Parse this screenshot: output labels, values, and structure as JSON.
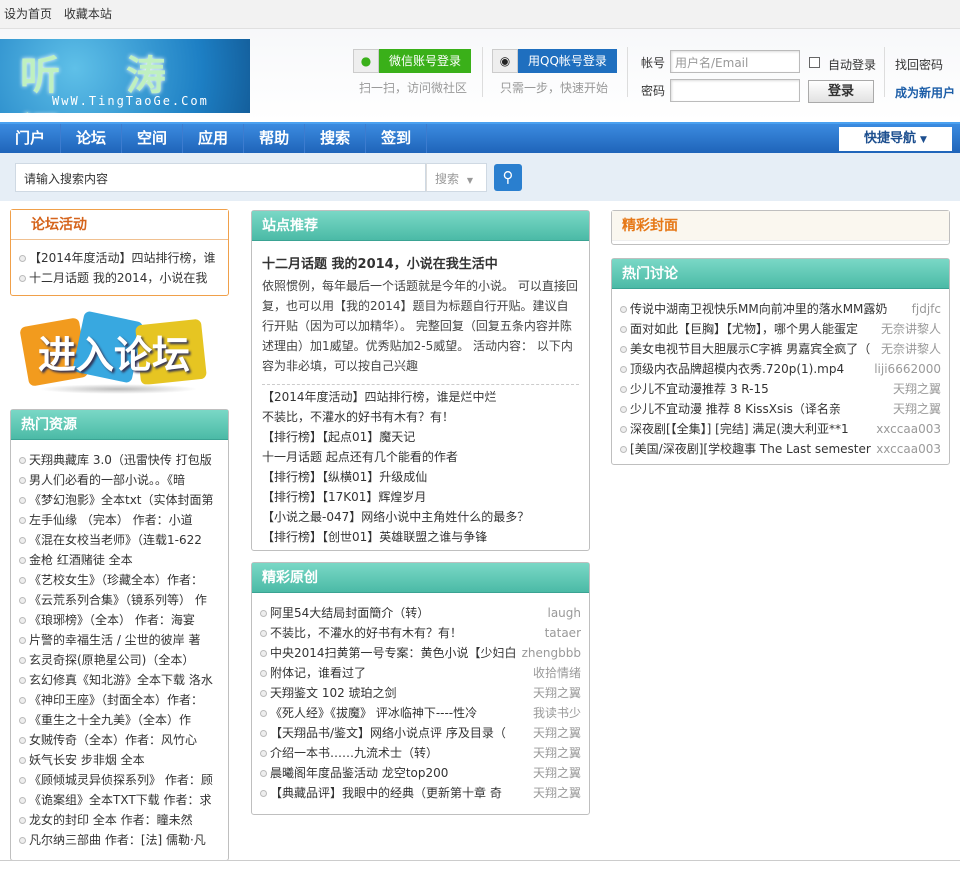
{
  "topbar": {
    "set_home": "设为首页",
    "bookmark": "收藏本站"
  },
  "logo": {
    "cn": "听 涛 阁",
    "en": "WwW.TingTaoGe.Com"
  },
  "login": {
    "wechat_btn": "微信账号登录",
    "wechat_hint": "扫一扫，访问微社区",
    "qq_btn": "用QQ帐号登录",
    "qq_hint": "只需一步，快速开始",
    "account_label": "帐号",
    "account_placeholder": "用户名/Email",
    "password_label": "密码",
    "auto_login": "自动登录",
    "submit": "登录",
    "find_password": "找回密码",
    "register": "成为新用户"
  },
  "nav": {
    "items": [
      "门户",
      "论坛",
      "空间",
      "应用",
      "帮助",
      "搜索",
      "签到"
    ],
    "quick": "快捷导航"
  },
  "search": {
    "placeholder": "请输入搜索内容",
    "type": "搜索"
  },
  "forum_activity": {
    "title": "论坛活动",
    "items": [
      "【2014年度活动】四站排行榜，谁",
      "十二月话题 我的2014，小说在我"
    ]
  },
  "enter_forum": "进入论坛",
  "hot_resources": {
    "title": "热门资源",
    "items": [
      "天翔典藏库 3.0（迅雷快传 打包版",
      "男人们必看的一部小说。。《暗",
      "《梦幻泡影》全本txt（实体封面第",
      "左手仙缘 （完本） 作者：小道",
      "《混在女校当老师》（连载1-622",
      "金枪 红酒赌徒 全本",
      "《艺校女生》（珍藏全本）作者：",
      "《云荒系列合集》（镜系列等） 作",
      "《琅琊榜》（全本） 作者：海宴",
      "片警的幸福生活 / 尘世的彼岸 著",
      "玄灵奇探(原艳星公司)（全本）",
      "玄幻修真《知北游》全本下载 洛水",
      "《神印王座》（封面全本）作者：",
      "《重生之十全九美》（全本）作",
      "女贼传奇（全本）作者：风竹心",
      "妖气长安 步非烟 全本",
      "《顾倾城灵异侦探系列》 作者：顾",
      "《诡案组》全本TXT下载 作者：求",
      "龙女的封印 全本 作者：瞳未然",
      "凡尔纳三部曲 作者：[法] 儒勒·凡"
    ]
  },
  "recommend": {
    "title": "站点推荐",
    "feature_title": "十二月话题 我的2014，小说在我生活中",
    "feature_desc": "依照惯例，每年最后一个话题就是今年的小说。 可以直接回复，也可以用【我的2014】题目为标题自行开贴。建议自行开贴（因为可以加精华）。 完整回复（回复五条内容并陈述理由）加1威望。优秀贴加2-5威望。 活动内容： 以下内容为非必填，可以按自己兴趣",
    "items": [
      "【2014年度活动】四站排行榜，谁是烂中烂",
      "不装比，不灌水的好书有木有？有！",
      "【排行榜】【起点01】魔天记",
      "十一月话题 起点还有几个能看的作者",
      "【排行榜】【纵横01】升级成仙",
      "【排行榜】【17K01】辉煌岁月",
      "【小说之最-047】网络小说中主角姓什么的最多？",
      "【排行榜】【创世01】英雄联盟之谁与争锋"
    ]
  },
  "original": {
    "title": "精彩原创",
    "items": [
      {
        "t": "阿里54大结局封面簡介（转）",
        "a": "laugh"
      },
      {
        "t": "不装比，不灌水的好书有木有？有！",
        "a": "tataer"
      },
      {
        "t": "中央2014扫黄第一号专案：黄色小说【少妇白",
        "a": "zhengbbb"
      },
      {
        "t": "附体记，谁看过了",
        "a": "收拾情绪"
      },
      {
        "t": "天翔鉴文 102 琥珀之剑",
        "a": "天翔之翼"
      },
      {
        "t": "《死人经》《拔魔》 评冰临神下----性冷",
        "a": "我读书少"
      },
      {
        "t": "【天翔品书/鉴文】网络小说点评 序及目录（",
        "a": "天翔之翼"
      },
      {
        "t": "介绍一本书……九流术士（转）",
        "a": "天翔之翼"
      },
      {
        "t": "晨曦阁年度品鉴活动 龙空top200",
        "a": "天翔之翼"
      },
      {
        "t": "【典藏品评】我眼中的经典（更新第十章 奇",
        "a": "天翔之翼"
      }
    ]
  },
  "covers": {
    "title": "精彩封面"
  },
  "hot_discuss": {
    "title": "热门讨论",
    "items": [
      {
        "t": "传说中湖南卫视快乐MM向前冲里的落水MM露奶",
        "a": "fjdjfc"
      },
      {
        "t": "面对如此【巨胸】【尤物】，哪个男人能蛋定",
        "a": "无奈讲黎人"
      },
      {
        "t": "美女电视节目大胆展示C字裤 男嘉宾全疯了（",
        "a": "无奈讲黎人"
      },
      {
        "t": "顶级内衣品牌超模内衣秀.720p(1).mp4",
        "a": "liji6662000"
      },
      {
        "t": "少儿不宜动漫推荐 3 R-15",
        "a": "天翔之翼"
      },
      {
        "t": "少儿不宜动漫 推荐 8 KissXsis（译名亲",
        "a": "天翔之翼"
      },
      {
        "t": "深夜剧[【全集】] [完结] 满足(澳大利亚**1",
        "a": "xxccaa003"
      },
      {
        "t": "[美国/深夜剧][学校趣事 The Last semester",
        "a": "xxccaa003"
      }
    ]
  }
}
